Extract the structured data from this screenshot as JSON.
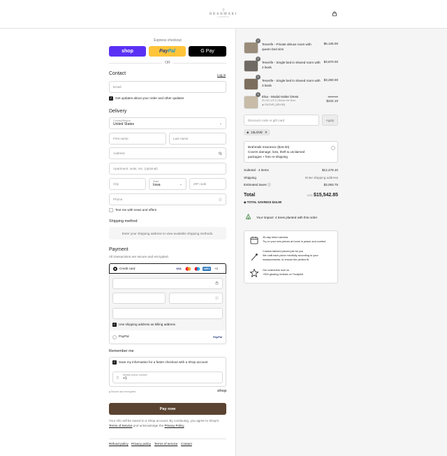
{
  "header": {
    "logo_mark": "◊",
    "brand": "BRAHMAKI",
    "brand_sub": "LONDON",
    "cart_icon": "bag-icon"
  },
  "express": {
    "label": "Express checkout",
    "shop": "shop",
    "paypal_a": "Pay",
    "paypal_b": "Pal",
    "gpay": "G Pay",
    "or": "OR"
  },
  "contact": {
    "title": "Contact",
    "login": "Log in",
    "email_placeholder": "Email",
    "updates_label": "Get updates about your order and other updates"
  },
  "delivery": {
    "title": "Delivery",
    "country_label": "Country/Region",
    "country_value": "United States",
    "first_name": "First name",
    "last_name": "Last name",
    "address": "Address",
    "apartment": "Apartment, suite, etc. (optional)",
    "city": "City",
    "state_label": "State",
    "state_value": "Iowa",
    "zip": "ZIP code",
    "phone": "Phone",
    "text_news": "Text me with news and offers"
  },
  "shipping": {
    "title": "Shipping method",
    "message": "Enter your shipping address to view available shipping methods."
  },
  "payment": {
    "title": "Payment",
    "subtitle": "All transactions are secure and encrypted.",
    "credit_card": "Credit card",
    "card_logos": [
      "VISA",
      "MC",
      "MC",
      "AMEX"
    ],
    "more_cards": "+1",
    "billing_same": "Use shipping address as billing address",
    "paypal": "PayPal",
    "paypal_logo": "PayPal"
  },
  "remember": {
    "title": "Remember me",
    "save_info": "Save my information for a faster checkout with a Shop account",
    "mobile_label": "Mobile phone number",
    "mobile_value": "+1",
    "secure": "Secure and encrypted",
    "shop_logo": "shop"
  },
  "pay_now": "Pay now",
  "legal": {
    "line1": "Your info will be saved to a Shop account. By continuing, you agree to Shop's",
    "terms": "Terms of Service",
    "and_ack": " and acknowledge the ",
    "privacy": "Privacy Policy",
    "period": "."
  },
  "footer": [
    "Refund policy",
    "Privacy policy",
    "Terms of service",
    "Contact"
  ],
  "order": {
    "items": [
      {
        "qty": "1",
        "name": "Tenerife - Private deluxe room with queen bed size",
        "price": "$5,125.00"
      },
      {
        "qty": "1",
        "name": "Tenerife - Single bed in shared room with 2 beds",
        "price": "$3,870.00"
      },
      {
        "qty": "1",
        "name": "Tenerife - Single bed in shared room with 3 beds",
        "price": "$3,260.00"
      },
      {
        "qty": "1",
        "name": "Elsa - Modal Halter Dress",
        "variant": "EU 50 | US 5 | Below the Bust",
        "discount": "10LOVE (-$24.90)",
        "old_price": "$249.00",
        "price": "$224.10"
      }
    ],
    "discount_placeholder": "Discount code or gift card",
    "apply": "Apply",
    "applied_code": "10LOVE",
    "insurance_title": "Brahmaki Insurance ($16.00)",
    "insurance_desc": "Covers damage, loss, theft & unclaimed packages + free re-shipping",
    "subtotal_label": "Subtotal · 4 items",
    "subtotal": "$12,479.10",
    "shipping_label": "Shipping",
    "shipping_value": "Enter shipping address",
    "taxes_label": "Estimated taxes",
    "taxes": "$3,063.75",
    "total_label": "Total",
    "currency": "USD",
    "total": "$15,542.85",
    "savings_label": "TOTAL SAVINGS",
    "savings": "$24.90",
    "impact": "Your Impact: 4 trees planted with this order",
    "perks": [
      {
        "title": "30-day return window",
        "desc": "Try on your new pieces at home in peace and comfort"
      },
      {
        "title": "Custom tailored pieces just for you",
        "desc": "We craft each piece mindfully according to your measurements, to ensure the perfect fit"
      },
      {
        "title": "Our customers love us",
        "desc": "+900 glowing reviews on Trustpilot"
      }
    ]
  }
}
